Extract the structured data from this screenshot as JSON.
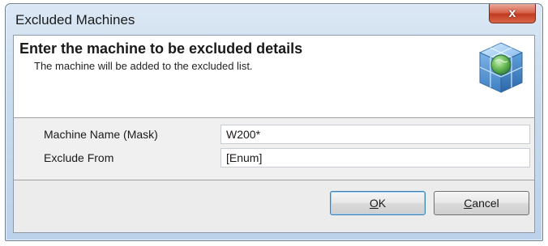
{
  "window": {
    "title": "Excluded Machines",
    "close_label": "x"
  },
  "header": {
    "title": "Enter the machine to be excluded details",
    "subtitle": "The machine will be added to the excluded list.",
    "icon": "globe-cube-icon"
  },
  "form": {
    "fields": [
      {
        "label": "Machine Name (Mask)",
        "value": "W200*"
      },
      {
        "label": "Exclude From",
        "value": "[Enum]"
      }
    ]
  },
  "buttons": {
    "ok": {
      "mnemonic": "O",
      "rest": "K"
    },
    "cancel": {
      "mnemonic": "C",
      "rest": "ancel"
    }
  }
}
